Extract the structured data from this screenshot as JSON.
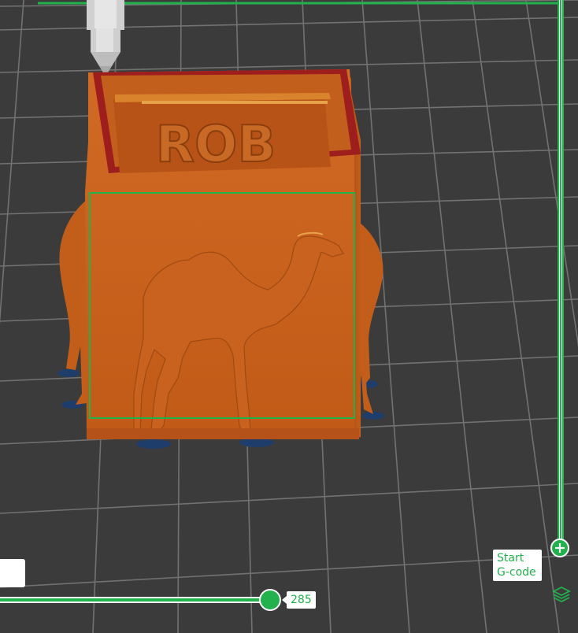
{
  "viewport": {
    "background_color": "#3b3b3b",
    "grid_color": "#6a6a6a",
    "accent_color": "#22b14c",
    "model_color": "#c8601e",
    "model_shadow_color": "#a34b12",
    "nozzle_color": "#d9d9d9",
    "model_text": "ROB",
    "icons": [
      "layers-icon",
      "add-icon"
    ]
  },
  "layer_slider": {
    "start_label_line1": "Start",
    "start_label_line2": "G-code"
  },
  "move_slider": {
    "value": "285"
  }
}
